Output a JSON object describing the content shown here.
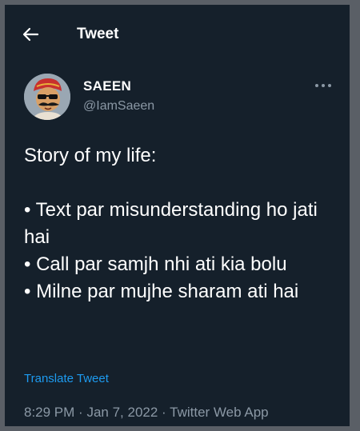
{
  "header": {
    "back_icon": "arrow-left-icon",
    "title": "Tweet"
  },
  "author": {
    "avatar_icon": "cartoon-avatar-with-turban-and-sunglasses",
    "display_name": "SAEEN",
    "handle": "@IamSaeen",
    "more_icon": "more-dots-icon"
  },
  "tweet": {
    "intro": "Story of my life:",
    "bullets": [
      "• Text par misunderstanding ho jati hai",
      "• Call par samjh nhi ati kia bolu",
      "• Milne par mujhe sharam ati hai"
    ],
    "translate_label": "Translate Tweet"
  },
  "meta": {
    "time": "8:29 PM",
    "separator": "·",
    "date": "Jan 7, 2022",
    "source": "Twitter Web App"
  },
  "colors": {
    "background": "#15202b",
    "text": "#ffffff",
    "muted": "#8b98a5",
    "accent": "#1d9bf0"
  }
}
